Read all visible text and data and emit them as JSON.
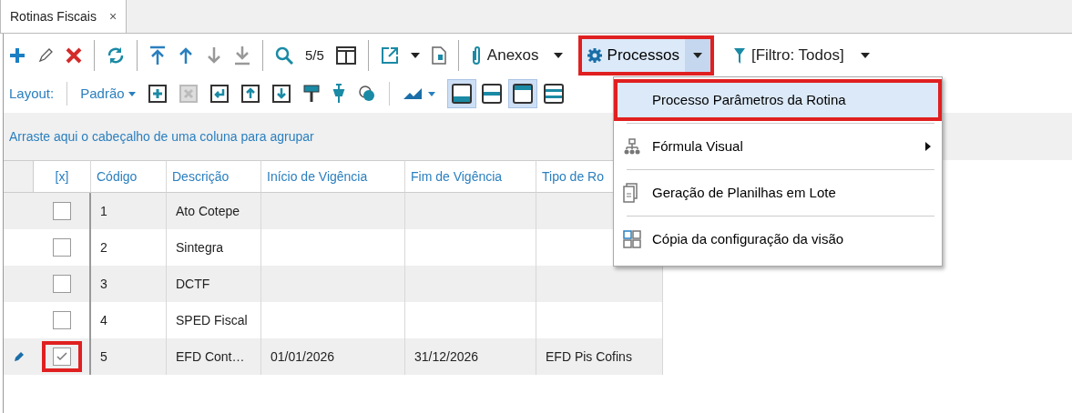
{
  "tabs": [
    {
      "label": "Rotinas Fiscais",
      "close": "×",
      "selected": true
    }
  ],
  "toolbar": {
    "record_count": "5/5",
    "attachments": "Anexos",
    "processes": {
      "label": "Processos",
      "highlighted": true
    },
    "filter": "[Filtro: Todos]"
  },
  "layout_bar": {
    "label": "Layout:",
    "preset": "Padrão",
    "toggles": [
      {
        "selected": true
      },
      {
        "selected": false
      },
      {
        "selected": true
      },
      {
        "selected": false
      }
    ]
  },
  "group_panel": {
    "hint": "Arraste aqui o cabeçalho de uma coluna para agrupar"
  },
  "table": {
    "checkbox_column": "[x]",
    "columns": [
      "Código",
      "Descrição",
      "Início de Vigência",
      "Fim de Vigência",
      "Tipo de Ro"
    ],
    "rows": [
      {
        "checked": false,
        "editing": false,
        "highlighted": false,
        "cells": [
          "1",
          "Ato Cotepe",
          "",
          "",
          ""
        ]
      },
      {
        "checked": false,
        "editing": false,
        "highlighted": false,
        "cells": [
          "2",
          "Sintegra",
          "",
          "",
          ""
        ]
      },
      {
        "checked": false,
        "editing": false,
        "highlighted": false,
        "cells": [
          "3",
          "DCTF",
          "",
          "",
          ""
        ]
      },
      {
        "checked": false,
        "editing": false,
        "highlighted": false,
        "cells": [
          "4",
          "SPED Fiscal",
          "",
          "",
          ""
        ]
      },
      {
        "checked": true,
        "editing": true,
        "highlighted": true,
        "cells": [
          "5",
          "EFD Cont…",
          "01/01/2026",
          "31/12/2026",
          "EFD Pis Cofins"
        ]
      }
    ]
  },
  "menu": {
    "items": [
      {
        "kind": "plain",
        "label": "Processo Parâmetros da Rotina",
        "selected": true,
        "highlighted": true,
        "submenu": false
      },
      {
        "kind": "hierarchy",
        "label": "Fórmula Visual",
        "selected": false,
        "highlighted": false,
        "submenu": true
      },
      {
        "kind": "sheets",
        "label": "Geração de Planilhas em Lote",
        "selected": false,
        "highlighted": false,
        "submenu": false
      },
      {
        "kind": "grid",
        "label": "Cópia da configuração da visão",
        "selected": false,
        "highlighted": false,
        "submenu": false
      }
    ]
  }
}
